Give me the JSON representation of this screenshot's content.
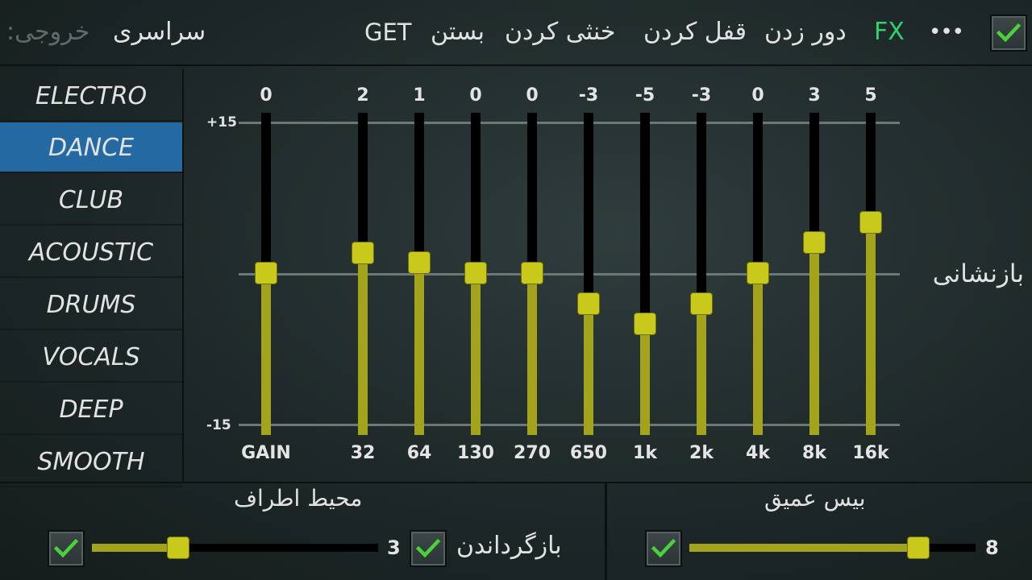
{
  "colors": {
    "accent_active": "#2469a2",
    "slider_fill": "#a4a41c",
    "slider_thumb": "#c9c91c",
    "fx_active": "#2fd36a",
    "check_green": "#4bd23b"
  },
  "topbar": {
    "output_label": "خروجی:",
    "output_value": "سراسری",
    "get_label": "GET",
    "close_label": "بستن",
    "mute_label": "خنثی کردن",
    "lock_label": "قفل کردن",
    "bypass_label": "دور زدن",
    "fx_label": "FX",
    "more_label": "•••",
    "enabled_checked": true
  },
  "presets": {
    "items": [
      "ELECTRO",
      "DANCE",
      "CLUB",
      "ACOUSTIC",
      "DRUMS",
      "VOCALS",
      "DEEP",
      "SMOOTH"
    ],
    "active_index": 1
  },
  "eq": {
    "scale_top": "+15",
    "scale_bottom": "-15",
    "range": [
      -15,
      15
    ],
    "bands": [
      {
        "label": "GAIN",
        "value": 0
      },
      {
        "label": "32",
        "value": 2
      },
      {
        "label": "64",
        "value": 1
      },
      {
        "label": "130",
        "value": 0
      },
      {
        "label": "270",
        "value": 0
      },
      {
        "label": "650",
        "value": -3
      },
      {
        "label": "1k",
        "value": -5
      },
      {
        "label": "2k",
        "value": -3
      },
      {
        "label": "4k",
        "value": 0
      },
      {
        "label": "8k",
        "value": 3
      },
      {
        "label": "16k",
        "value": 5
      }
    ],
    "reset_label": "بازنشانی"
  },
  "surround": {
    "title": "محیط اطراف",
    "checked": true,
    "value": 3,
    "level_fraction": 0.3,
    "restore_label": "بازگرداندن",
    "restore_checked": true
  },
  "bass": {
    "title": "بیس عمیق",
    "checked": true,
    "value": 8,
    "level_fraction": 0.8
  }
}
